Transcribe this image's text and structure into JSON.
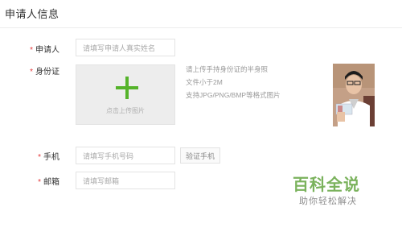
{
  "section": {
    "title": "申请人信息"
  },
  "form": {
    "name": {
      "required_mark": "*",
      "label": "申请人",
      "placeholder": "请填写申请人真实姓名"
    },
    "id_card": {
      "required_mark": "*",
      "label": "身份证",
      "upload_text": "点击上传图片",
      "hints": [
        "请上传手持身份证的半身照",
        "文件小于2M",
        "支持JPG/PNG/BMP等格式图片"
      ]
    },
    "phone": {
      "required_mark": "*",
      "label": "手机",
      "placeholder": "请填写手机号码",
      "verify_button": "验证手机"
    },
    "email": {
      "required_mark": "*",
      "label": "邮箱",
      "placeholder": "请填写邮箱"
    }
  },
  "watermark": {
    "title": "百科全说",
    "subtitle": "助你轻松解决"
  },
  "colors": {
    "plus_icon": "#55b32a",
    "required": "#e4393c",
    "watermark": "#7ab25c"
  }
}
